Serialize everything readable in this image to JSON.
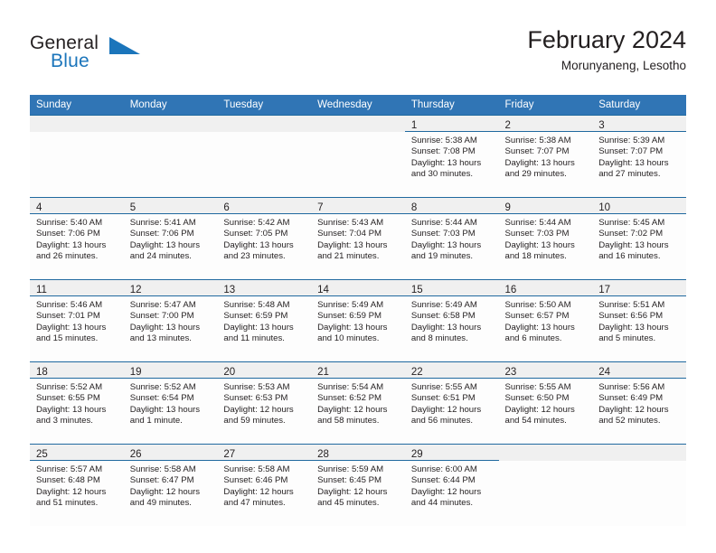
{
  "brand": {
    "line1": "General",
    "line2": "Blue",
    "triangle_icon": "brand-triangle-icon",
    "accent_color": "#1b75bb"
  },
  "header": {
    "title": "February 2024",
    "subtitle": "Morunyaneng, Lesotho"
  },
  "theme": {
    "header_bg": "#3075b5",
    "rule_color": "#20699f",
    "daynum_bg": "#f0f0f0",
    "text_color": "#231f20"
  },
  "calendar": {
    "weekday_headers": [
      "Sunday",
      "Monday",
      "Tuesday",
      "Wednesday",
      "Thursday",
      "Friday",
      "Saturday"
    ],
    "weeks": [
      [
        {
          "day": "",
          "lines": []
        },
        {
          "day": "",
          "lines": []
        },
        {
          "day": "",
          "lines": []
        },
        {
          "day": "",
          "lines": []
        },
        {
          "day": "1",
          "lines": [
            "Sunrise: 5:38 AM",
            "Sunset: 7:08 PM",
            "Daylight: 13 hours",
            "and 30 minutes."
          ]
        },
        {
          "day": "2",
          "lines": [
            "Sunrise: 5:38 AM",
            "Sunset: 7:07 PM",
            "Daylight: 13 hours",
            "and 29 minutes."
          ]
        },
        {
          "day": "3",
          "lines": [
            "Sunrise: 5:39 AM",
            "Sunset: 7:07 PM",
            "Daylight: 13 hours",
            "and 27 minutes."
          ]
        }
      ],
      [
        {
          "day": "4",
          "lines": [
            "Sunrise: 5:40 AM",
            "Sunset: 7:06 PM",
            "Daylight: 13 hours",
            "and 26 minutes."
          ]
        },
        {
          "day": "5",
          "lines": [
            "Sunrise: 5:41 AM",
            "Sunset: 7:06 PM",
            "Daylight: 13 hours",
            "and 24 minutes."
          ]
        },
        {
          "day": "6",
          "lines": [
            "Sunrise: 5:42 AM",
            "Sunset: 7:05 PM",
            "Daylight: 13 hours",
            "and 23 minutes."
          ]
        },
        {
          "day": "7",
          "lines": [
            "Sunrise: 5:43 AM",
            "Sunset: 7:04 PM",
            "Daylight: 13 hours",
            "and 21 minutes."
          ]
        },
        {
          "day": "8",
          "lines": [
            "Sunrise: 5:44 AM",
            "Sunset: 7:03 PM",
            "Daylight: 13 hours",
            "and 19 minutes."
          ]
        },
        {
          "day": "9",
          "lines": [
            "Sunrise: 5:44 AM",
            "Sunset: 7:03 PM",
            "Daylight: 13 hours",
            "and 18 minutes."
          ]
        },
        {
          "day": "10",
          "lines": [
            "Sunrise: 5:45 AM",
            "Sunset: 7:02 PM",
            "Daylight: 13 hours",
            "and 16 minutes."
          ]
        }
      ],
      [
        {
          "day": "11",
          "lines": [
            "Sunrise: 5:46 AM",
            "Sunset: 7:01 PM",
            "Daylight: 13 hours",
            "and 15 minutes."
          ]
        },
        {
          "day": "12",
          "lines": [
            "Sunrise: 5:47 AM",
            "Sunset: 7:00 PM",
            "Daylight: 13 hours",
            "and 13 minutes."
          ]
        },
        {
          "day": "13",
          "lines": [
            "Sunrise: 5:48 AM",
            "Sunset: 6:59 PM",
            "Daylight: 13 hours",
            "and 11 minutes."
          ]
        },
        {
          "day": "14",
          "lines": [
            "Sunrise: 5:49 AM",
            "Sunset: 6:59 PM",
            "Daylight: 13 hours",
            "and 10 minutes."
          ]
        },
        {
          "day": "15",
          "lines": [
            "Sunrise: 5:49 AM",
            "Sunset: 6:58 PM",
            "Daylight: 13 hours",
            "and 8 minutes."
          ]
        },
        {
          "day": "16",
          "lines": [
            "Sunrise: 5:50 AM",
            "Sunset: 6:57 PM",
            "Daylight: 13 hours",
            "and 6 minutes."
          ]
        },
        {
          "day": "17",
          "lines": [
            "Sunrise: 5:51 AM",
            "Sunset: 6:56 PM",
            "Daylight: 13 hours",
            "and 5 minutes."
          ]
        }
      ],
      [
        {
          "day": "18",
          "lines": [
            "Sunrise: 5:52 AM",
            "Sunset: 6:55 PM",
            "Daylight: 13 hours",
            "and 3 minutes."
          ]
        },
        {
          "day": "19",
          "lines": [
            "Sunrise: 5:52 AM",
            "Sunset: 6:54 PM",
            "Daylight: 13 hours",
            "and 1 minute."
          ]
        },
        {
          "day": "20",
          "lines": [
            "Sunrise: 5:53 AM",
            "Sunset: 6:53 PM",
            "Daylight: 12 hours",
            "and 59 minutes."
          ]
        },
        {
          "day": "21",
          "lines": [
            "Sunrise: 5:54 AM",
            "Sunset: 6:52 PM",
            "Daylight: 12 hours",
            "and 58 minutes."
          ]
        },
        {
          "day": "22",
          "lines": [
            "Sunrise: 5:55 AM",
            "Sunset: 6:51 PM",
            "Daylight: 12 hours",
            "and 56 minutes."
          ]
        },
        {
          "day": "23",
          "lines": [
            "Sunrise: 5:55 AM",
            "Sunset: 6:50 PM",
            "Daylight: 12 hours",
            "and 54 minutes."
          ]
        },
        {
          "day": "24",
          "lines": [
            "Sunrise: 5:56 AM",
            "Sunset: 6:49 PM",
            "Daylight: 12 hours",
            "and 52 minutes."
          ]
        }
      ],
      [
        {
          "day": "25",
          "lines": [
            "Sunrise: 5:57 AM",
            "Sunset: 6:48 PM",
            "Daylight: 12 hours",
            "and 51 minutes."
          ]
        },
        {
          "day": "26",
          "lines": [
            "Sunrise: 5:58 AM",
            "Sunset: 6:47 PM",
            "Daylight: 12 hours",
            "and 49 minutes."
          ]
        },
        {
          "day": "27",
          "lines": [
            "Sunrise: 5:58 AM",
            "Sunset: 6:46 PM",
            "Daylight: 12 hours",
            "and 47 minutes."
          ]
        },
        {
          "day": "28",
          "lines": [
            "Sunrise: 5:59 AM",
            "Sunset: 6:45 PM",
            "Daylight: 12 hours",
            "and 45 minutes."
          ]
        },
        {
          "day": "29",
          "lines": [
            "Sunrise: 6:00 AM",
            "Sunset: 6:44 PM",
            "Daylight: 12 hours",
            "and 44 minutes."
          ]
        },
        {
          "day": "",
          "lines": []
        },
        {
          "day": "",
          "lines": []
        }
      ]
    ]
  }
}
